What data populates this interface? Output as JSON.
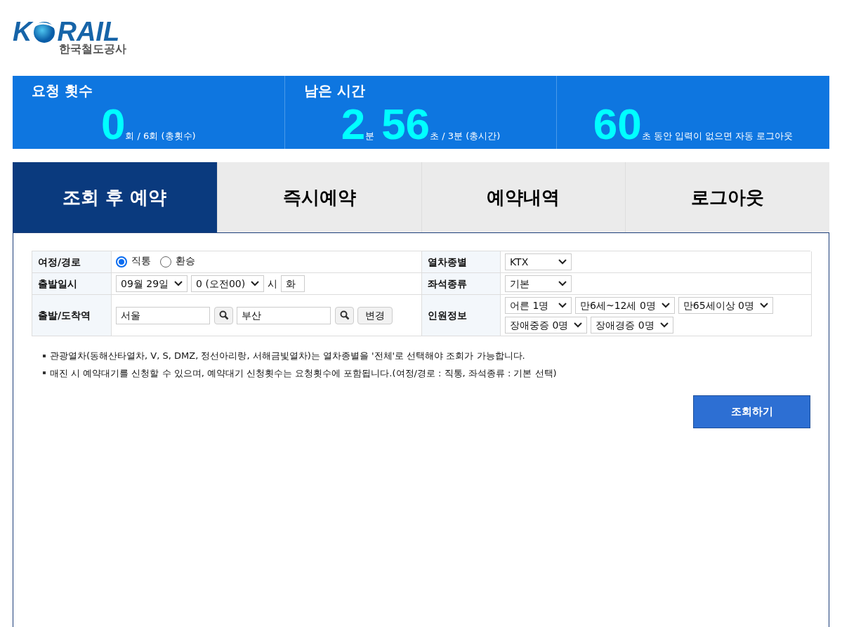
{
  "logo": {
    "prefix": "K",
    "suffix": "RAIL",
    "subtitle": "한국철도공사"
  },
  "stats": [
    {
      "title": "요청 횟수",
      "segments": [
        {
          "kind": "big",
          "text": "0"
        },
        {
          "kind": "small",
          "text": "회 / 6회 (총횟수)"
        }
      ]
    },
    {
      "title": "남은 시간",
      "segments": [
        {
          "kind": "big",
          "text": "2"
        },
        {
          "kind": "small",
          "text": "분"
        },
        {
          "kind": "big",
          "text": "56"
        },
        {
          "kind": "small",
          "text": "초 / 3분 (총시간)"
        }
      ]
    },
    {
      "segments": [
        {
          "kind": "big",
          "text": "60"
        },
        {
          "kind": "small",
          "text": "초 동안 입력이 없으면 자동 로그아웃"
        }
      ]
    }
  ],
  "tabs": [
    {
      "label": "조회 후 예약",
      "selected": true
    },
    {
      "label": "즉시예약",
      "selected": false
    },
    {
      "label": "예약내역",
      "selected": false
    },
    {
      "label": "로그아웃",
      "selected": false
    }
  ],
  "form_rows": [
    {
      "left": {
        "label": "여정/경로",
        "controls": [
          {
            "kind": "radio",
            "label": "직통",
            "selected": true
          },
          {
            "kind": "radio",
            "label": "환승",
            "selected": false
          }
        ]
      },
      "right": {
        "label": "열차종별",
        "controls": [
          {
            "kind": "select",
            "value": "KTX"
          }
        ]
      }
    },
    {
      "left": {
        "label": "출발일시",
        "controls": [
          {
            "kind": "select",
            "value": "09월 29일"
          },
          {
            "kind": "select",
            "value": "0 (오전00)"
          },
          {
            "kind": "text",
            "value": "시"
          },
          {
            "kind": "input",
            "value": "화"
          }
        ]
      },
      "right": {
        "label": "좌석종류",
        "controls": [
          {
            "kind": "select",
            "value": "기본"
          }
        ]
      }
    },
    {
      "left": {
        "label": "출발/도착역",
        "controls": [
          {
            "kind": "station",
            "value": "서울"
          },
          {
            "kind": "station",
            "value": "부산"
          },
          {
            "kind": "button",
            "value": "변경"
          }
        ]
      },
      "right": {
        "label": "인원정보",
        "controls": [
          {
            "kind": "select",
            "value": "어른 1명"
          },
          {
            "kind": "select",
            "value": "만6세~12세 0명"
          },
          {
            "kind": "select",
            "value": "만65세이상 0명"
          },
          {
            "kind": "select",
            "value": "장애중증 0명"
          },
          {
            "kind": "select",
            "value": "장애경증 0명"
          }
        ]
      }
    }
  ],
  "notes": [
    "관광열차(동해산타열차, V, S, DMZ, 정선아리랑, 서해금빛열차)는 열차종별을 '전체'로 선택해야 조회가 가능합니다.",
    "매진 시 예약대기를 신청할 수 있으며, 예약대기 신청횟수는 요청횟수에 포함됩니다.(여정/경로 : 직통, 좌석종류 : 기본 선택)"
  ],
  "search_button": "조회하기"
}
